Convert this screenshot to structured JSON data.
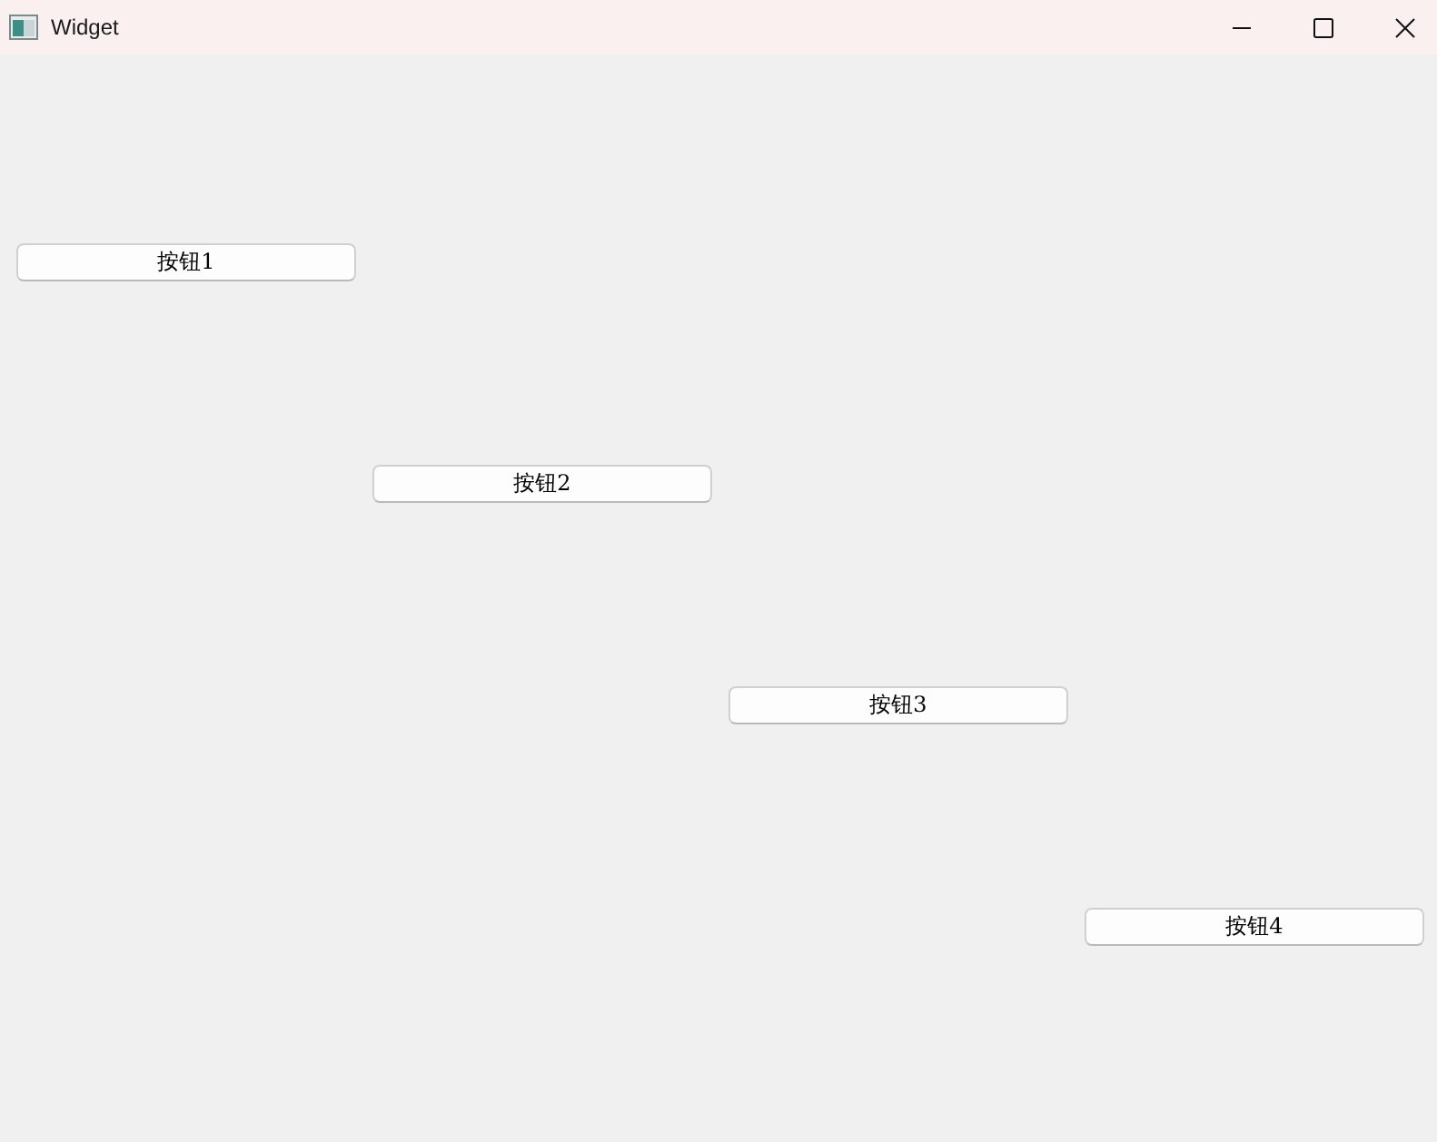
{
  "window": {
    "title": "Widget"
  },
  "buttons": [
    {
      "label": "按钮1"
    },
    {
      "label": "按钮2"
    },
    {
      "label": "按钮3"
    },
    {
      "label": "按钮4"
    }
  ]
}
